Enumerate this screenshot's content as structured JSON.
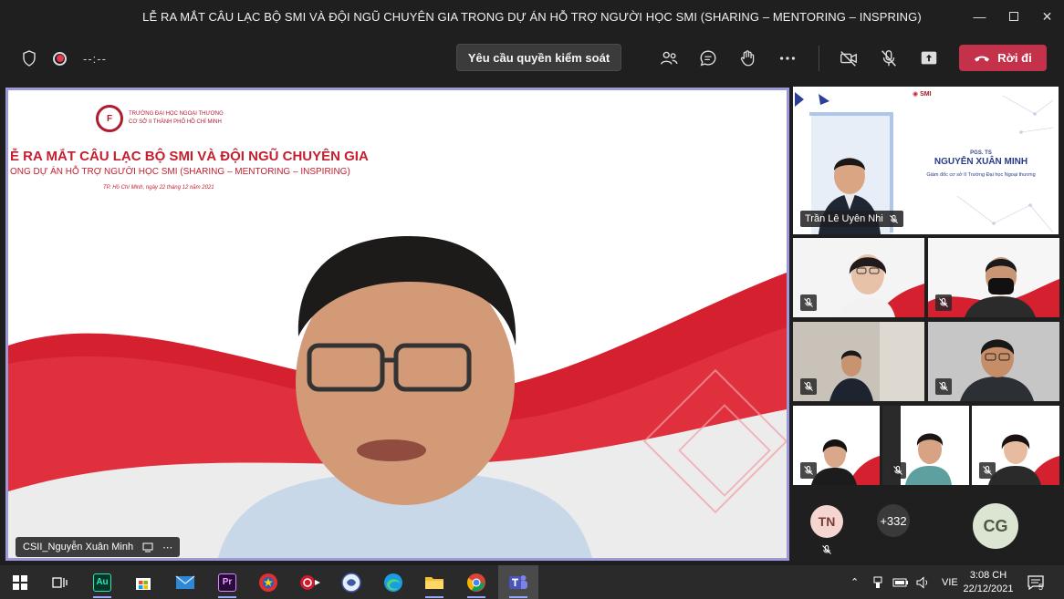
{
  "window": {
    "title": "LỄ RA MẮT CÂU LẠC BỘ SMI VÀ ĐỘI NGŨ CHUYÊN GIA TRONG DỰ ÁN HỖ TRỢ NGƯỜI HỌC SMI (SHARING – MENTORING – INSPRING)",
    "controls": [
      "minimize",
      "maximize",
      "close"
    ]
  },
  "toolbar": {
    "timer": "--:--",
    "request_control_label": "Yêu cầu quyền kiểm soát",
    "leave_label": "Rời đi",
    "icons": [
      "people-icon",
      "chat-icon",
      "raise-hand-icon",
      "more-options-icon",
      "camera-off-icon",
      "mic-off-icon",
      "share-screen-icon"
    ]
  },
  "main_video": {
    "speaker_name": "CSII_Nguyễn Xuân Minh",
    "slide": {
      "school_line1": "TRƯỜNG ĐẠI HỌC NGOẠI THƯƠNG",
      "school_line2": "CƠ SỞ II THÀNH PHỐ HỒ CHÍ MINH",
      "heading": "Ễ RA MẮT CÂU LẠC BỘ SMI VÀ ĐỘI NGŨ CHUYÊN GIA",
      "subheading": "ONG DỰ ÁN HỖ TRỢ NGƯỜI HỌC SMI (SHARING – MENTORING – INSPIRING)",
      "date": "TP. Hồ Chí Minh, ngày 22 tháng 12 năm 2021"
    }
  },
  "presenter_tile": {
    "participant_name": "Trần Lê Uyên Nhi",
    "card_title": "PGS. TS",
    "card_name": "NGUYỄN XUÂN MINH",
    "card_subtitle": "Giám đốc cơ sở II Trường Đại học Ngoại thương",
    "logo_text": "SMI"
  },
  "participants": {
    "tn_initials": "TN",
    "overflow_count": "+332",
    "cg_initials": "CG"
  },
  "taskbar": {
    "apps": [
      "start",
      "task-view",
      "audition",
      "store",
      "mail",
      "premiere",
      "youth-union",
      "screen-recorder",
      "vpn",
      "edge",
      "file-explorer",
      "chrome",
      "teams"
    ],
    "language": "VIE",
    "time": "3:08 CH",
    "date": "22/12/2021",
    "notification_count": "5"
  },
  "colors": {
    "leave_red": "#c4314b",
    "active_border": "#9c98d9",
    "slide_red": "#c41e2f"
  }
}
